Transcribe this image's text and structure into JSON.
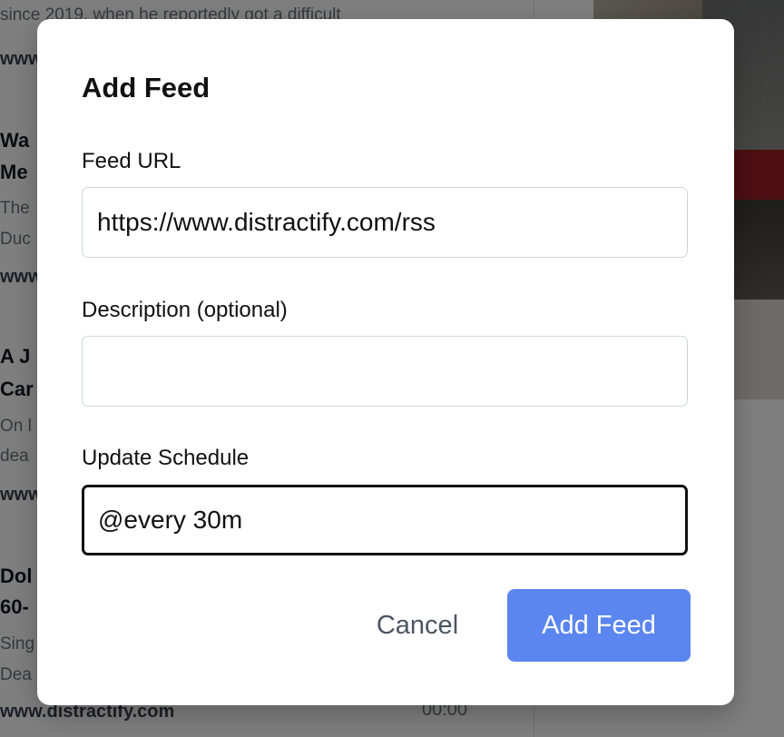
{
  "background": {
    "articles": [
      {
        "title_lines": [],
        "description_lines": [
          "since 2019, when he reportedly got a difficult"
        ],
        "source": "www"
      },
      {
        "title_lines": [
          "Wa",
          "Me"
        ],
        "description_lines": [
          "The",
          "Duc"
        ],
        "source": "www"
      },
      {
        "title_lines": [
          "A J",
          "Car"
        ],
        "description_lines": [
          "On l",
          "dea"
        ],
        "source": "www"
      },
      {
        "title_lines": [
          "Dol",
          "60-"
        ],
        "description_lines": [
          "Sing",
          "Dea"
        ],
        "source": "www.distractify.com",
        "time": "00:00"
      }
    ]
  },
  "modal": {
    "title": "Add Feed",
    "feed_url": {
      "label": "Feed URL",
      "value": "https://www.distractify.com/rss"
    },
    "description": {
      "label": "Description (optional)",
      "value": ""
    },
    "schedule": {
      "label": "Update Schedule",
      "value": "@every 30m"
    },
    "cancel_label": "Cancel",
    "submit_label": "Add Feed"
  },
  "colors": {
    "primary": "#5b86f0",
    "overlay": "rgba(0,0,0,0.5)"
  }
}
